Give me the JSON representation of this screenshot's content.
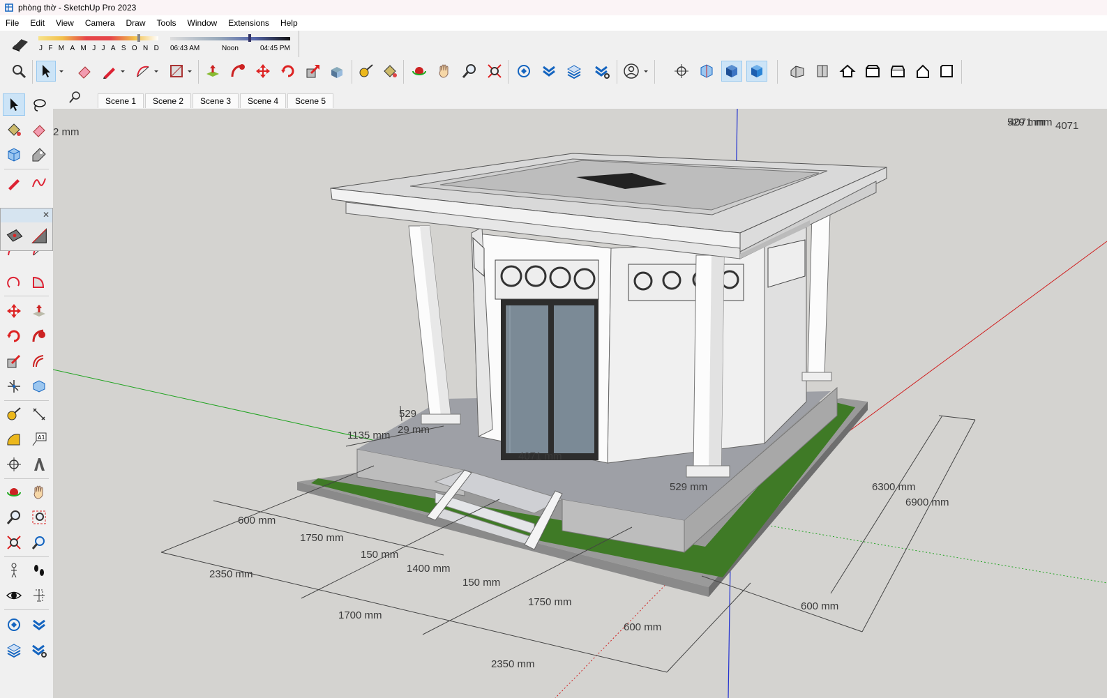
{
  "window": {
    "title": "phòng thờ - SketchUp Pro 2023"
  },
  "menu": [
    "File",
    "Edit",
    "View",
    "Camera",
    "Draw",
    "Tools",
    "Window",
    "Extensions",
    "Help"
  ],
  "shadows": {
    "months": [
      "J",
      "F",
      "M",
      "A",
      "M",
      "J",
      "J",
      "A",
      "S",
      "O",
      "N",
      "D"
    ],
    "time_start": "06:43 AM",
    "time_mid": "Noon",
    "time_end": "04:45 PM"
  },
  "scenes": [
    "Scene 1",
    "Scene 2",
    "Scene 3",
    "Scene 4",
    "Scene 5"
  ],
  "dimensions": {
    "top_left": "2 mm",
    "top_right_a": "529 mm",
    "top_right_b": "4071 mm",
    "top_right_c": "4071",
    "d529a": "529",
    "d29": "29 mm",
    "d1135": "1135 mm",
    "d4071": "4071 mm",
    "d529b": "529 mm",
    "d600a": "600 mm",
    "d1750a": "1750 mm",
    "d150a": "150 mm",
    "d1400": "1400 mm",
    "d150b": "150 mm",
    "d2350a": "2350 mm",
    "d1700": "1700 mm",
    "d1750b": "1750 mm",
    "d600b": "600 mm",
    "d2350b": "2350 mm",
    "d6300": "6300 mm",
    "d6900": "6900 mm",
    "d600c": "600 mm"
  },
  "colors": {
    "axis_green": "#1fa31f",
    "axis_red": "#d02020",
    "axis_blue": "#2030d0",
    "grass": "#3f7a26",
    "sky": "#d4d3d0"
  }
}
